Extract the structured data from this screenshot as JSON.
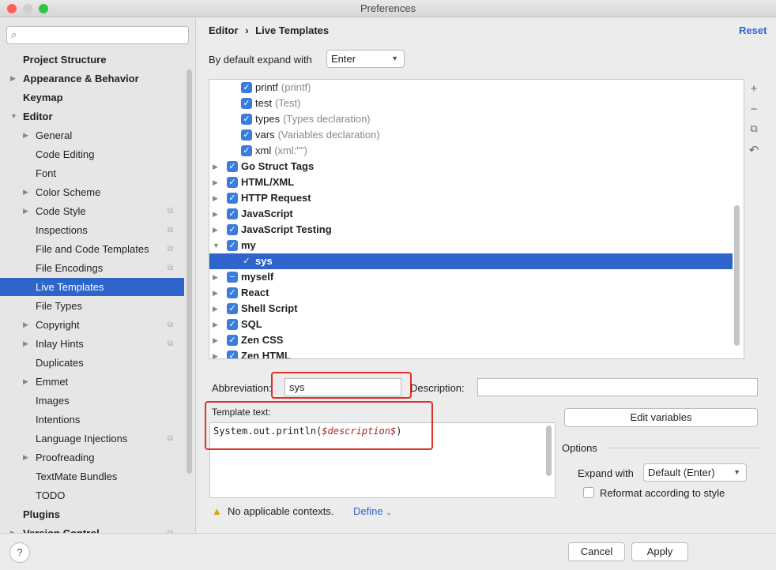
{
  "window": {
    "title": "Preferences"
  },
  "sidebar": {
    "search_placeholder": "",
    "items": [
      {
        "label": "Project Structure",
        "level": 0,
        "bold": true
      },
      {
        "label": "Appearance & Behavior",
        "level": 0,
        "bold": true,
        "expandable": true
      },
      {
        "label": "Keymap",
        "level": 0,
        "bold": true
      },
      {
        "label": "Editor",
        "level": 0,
        "bold": true,
        "expanded": true
      },
      {
        "label": "General",
        "level": 1,
        "expandable": true
      },
      {
        "label": "Code Editing",
        "level": 1
      },
      {
        "label": "Font",
        "level": 1
      },
      {
        "label": "Color Scheme",
        "level": 1,
        "expandable": true
      },
      {
        "label": "Code Style",
        "level": 1,
        "expandable": true,
        "project": true
      },
      {
        "label": "Inspections",
        "level": 1,
        "project": true
      },
      {
        "label": "File and Code Templates",
        "level": 1,
        "project": true
      },
      {
        "label": "File Encodings",
        "level": 1,
        "project": true
      },
      {
        "label": "Live Templates",
        "level": 1,
        "selected": true
      },
      {
        "label": "File Types",
        "level": 1
      },
      {
        "label": "Copyright",
        "level": 1,
        "expandable": true,
        "project": true
      },
      {
        "label": "Inlay Hints",
        "level": 1,
        "expandable": true,
        "project": true
      },
      {
        "label": "Duplicates",
        "level": 1
      },
      {
        "label": "Emmet",
        "level": 1,
        "expandable": true
      },
      {
        "label": "Images",
        "level": 1
      },
      {
        "label": "Intentions",
        "level": 1
      },
      {
        "label": "Language Injections",
        "level": 1,
        "project": true
      },
      {
        "label": "Proofreading",
        "level": 1,
        "expandable": true
      },
      {
        "label": "TextMate Bundles",
        "level": 1
      },
      {
        "label": "TODO",
        "level": 1
      },
      {
        "label": "Plugins",
        "level": 0,
        "bold": true
      },
      {
        "label": "Version Control",
        "level": 0,
        "bold": true,
        "expandable": true,
        "project": true
      }
    ]
  },
  "header": {
    "breadcrumb_parent": "Editor",
    "breadcrumb_sep": "›",
    "breadcrumb_current": "Live Templates",
    "reset": "Reset"
  },
  "expand": {
    "label": "By default expand with",
    "value": "Enter"
  },
  "tree": [
    {
      "name": "printf",
      "desc": "(printf)",
      "child": true,
      "state": "checked"
    },
    {
      "name": "test",
      "desc": "(Test)",
      "child": true,
      "state": "checked"
    },
    {
      "name": "types",
      "desc": "(Types declaration)",
      "child": true,
      "state": "checked"
    },
    {
      "name": "vars",
      "desc": "(Variables declaration)",
      "child": true,
      "state": "checked"
    },
    {
      "name": "xml",
      "desc": "(xml:\"\")",
      "child": true,
      "state": "checked"
    },
    {
      "name": "Go Struct Tags",
      "state": "checked"
    },
    {
      "name": "HTML/XML",
      "state": "checked"
    },
    {
      "name": "HTTP Request",
      "state": "checked"
    },
    {
      "name": "JavaScript",
      "state": "checked"
    },
    {
      "name": "JavaScript Testing",
      "state": "checked"
    },
    {
      "name": "my",
      "state": "checked",
      "expanded": true
    },
    {
      "name": "sys",
      "child": true,
      "state": "checked",
      "selected": true
    },
    {
      "name": "myself",
      "state": "partial"
    },
    {
      "name": "React",
      "state": "checked"
    },
    {
      "name": "Shell Script",
      "state": "checked"
    },
    {
      "name": "SQL",
      "state": "checked"
    },
    {
      "name": "Zen CSS",
      "state": "checked"
    },
    {
      "name": "Zen HTML",
      "state": "checked"
    }
  ],
  "toolbar": {
    "add": "+",
    "remove": "−",
    "copy": "⧉",
    "restore": "↶"
  },
  "form": {
    "abbreviation_label": "Abbreviation:",
    "abbreviation": "sys",
    "description_label": "Description:",
    "description": "",
    "template_label": "Template text:",
    "template_prefix": "System.out.println(",
    "template_var": "$description$",
    "template_suffix": ")",
    "edit_variables": "Edit variables",
    "options_label": "Options",
    "expand_with_label": "Expand with",
    "expand_with_value": "Default (Enter)",
    "reformat_label": "Reformat according to style",
    "warning": "No applicable contexts.",
    "define": "Define"
  },
  "footer": {
    "help": "?",
    "cancel": "Cancel",
    "apply": "Apply"
  },
  "colors": {
    "selection": "#2f65ca",
    "highlight": "#e0302a",
    "link": "#2f65ca"
  }
}
